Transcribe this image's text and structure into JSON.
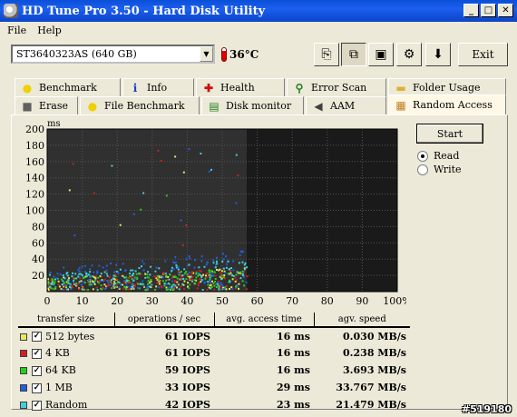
{
  "window": {
    "title": "HD Tune Pro 3.50 - Hard Disk Utility"
  },
  "menu": [
    {
      "label": "File"
    },
    {
      "label": "Help"
    }
  ],
  "toolbar": {
    "drive": "ST3640323AS (640 GB)",
    "temperature": "36°C",
    "exit_label": "Exit",
    "buttons": [
      {
        "name": "copy-text-icon",
        "glyph": "⎘"
      },
      {
        "name": "copy-screenshot-icon",
        "glyph": "⧉"
      },
      {
        "name": "save-icon",
        "glyph": "▣"
      },
      {
        "name": "options-icon",
        "glyph": "⚙"
      },
      {
        "name": "download-icon",
        "glyph": "⬇"
      }
    ]
  },
  "tabs_row1": [
    {
      "label": "Benchmark",
      "icon": "benchmark-icon",
      "glyph": "●",
      "color": "#f0d000"
    },
    {
      "label": "Info",
      "icon": "info-icon",
      "glyph": "i",
      "color": "#1c3cc8"
    },
    {
      "label": "Health",
      "icon": "health-icon",
      "glyph": "✚",
      "color": "#d01010"
    },
    {
      "label": "Error Scan",
      "icon": "error-scan-icon",
      "glyph": "⚲",
      "color": "#208020"
    },
    {
      "label": "Folder Usage",
      "icon": "folder-icon",
      "glyph": "▬",
      "color": "#e0b030"
    }
  ],
  "tabs_row2": [
    {
      "label": "Erase",
      "icon": "erase-icon",
      "glyph": "■",
      "color": "#606060"
    },
    {
      "label": "File Benchmark",
      "icon": "file-benchmark-icon",
      "glyph": "●",
      "color": "#f0d000"
    },
    {
      "label": "Disk monitor",
      "icon": "disk-monitor-icon",
      "glyph": "▤",
      "color": "#208020"
    },
    {
      "label": "AAM",
      "icon": "speaker-icon",
      "glyph": "◀",
      "color": "#404040"
    },
    {
      "label": "Random Access",
      "icon": "random-access-icon",
      "glyph": "▦",
      "color": "#c08020",
      "active": true
    }
  ],
  "controls": {
    "start_label": "Start",
    "read_label": "Read",
    "write_label": "Write",
    "mode": "read"
  },
  "chart_data": {
    "type": "scatter",
    "ylabel": "ms",
    "ylim": [
      0,
      200
    ],
    "xlim": [
      0,
      100
    ],
    "y_ticks": [
      20,
      40,
      60,
      80,
      100,
      120,
      140,
      160,
      180,
      200
    ],
    "x_ticks": [
      "0",
      "10",
      "20",
      "30",
      "40",
      "50",
      "60",
      "70",
      "80",
      "90",
      "100%"
    ],
    "progress_percent": 57,
    "background": "#1a1a1a",
    "grid": true,
    "series": [
      {
        "name": "512 bytes",
        "color": "#e8e860",
        "access_ms": 16
      },
      {
        "name": "4 KB",
        "color": "#d02020",
        "access_ms": 16
      },
      {
        "name": "64 KB",
        "color": "#20d020",
        "access_ms": 16
      },
      {
        "name": "1 MB",
        "color": "#2060e0",
        "access_ms": 29
      },
      {
        "name": "Random",
        "color": "#40d0e0",
        "access_ms": 23
      }
    ]
  },
  "table": {
    "headers": [
      "transfer size",
      "operations / sec",
      "avg. access time",
      "agv. speed"
    ],
    "rows": [
      {
        "size": "512 bytes",
        "color": "#e8e860",
        "ops": "61 IOPS",
        "access": "16 ms",
        "speed": "0.030 MB/s"
      },
      {
        "size": "4 KB",
        "color": "#d02020",
        "ops": "61 IOPS",
        "access": "16 ms",
        "speed": "0.238 MB/s"
      },
      {
        "size": "64 KB",
        "color": "#20d020",
        "ops": "59 IOPS",
        "access": "16 ms",
        "speed": "3.693 MB/s"
      },
      {
        "size": "1 MB",
        "color": "#2060e0",
        "ops": "33 IOPS",
        "access": "29 ms",
        "speed": "33.767 MB/s"
      },
      {
        "size": "Random",
        "color": "#40d0e0",
        "ops": "42 IOPS",
        "access": "23 ms",
        "speed": "21.479 MB/s"
      }
    ]
  },
  "watermark": "#519180"
}
